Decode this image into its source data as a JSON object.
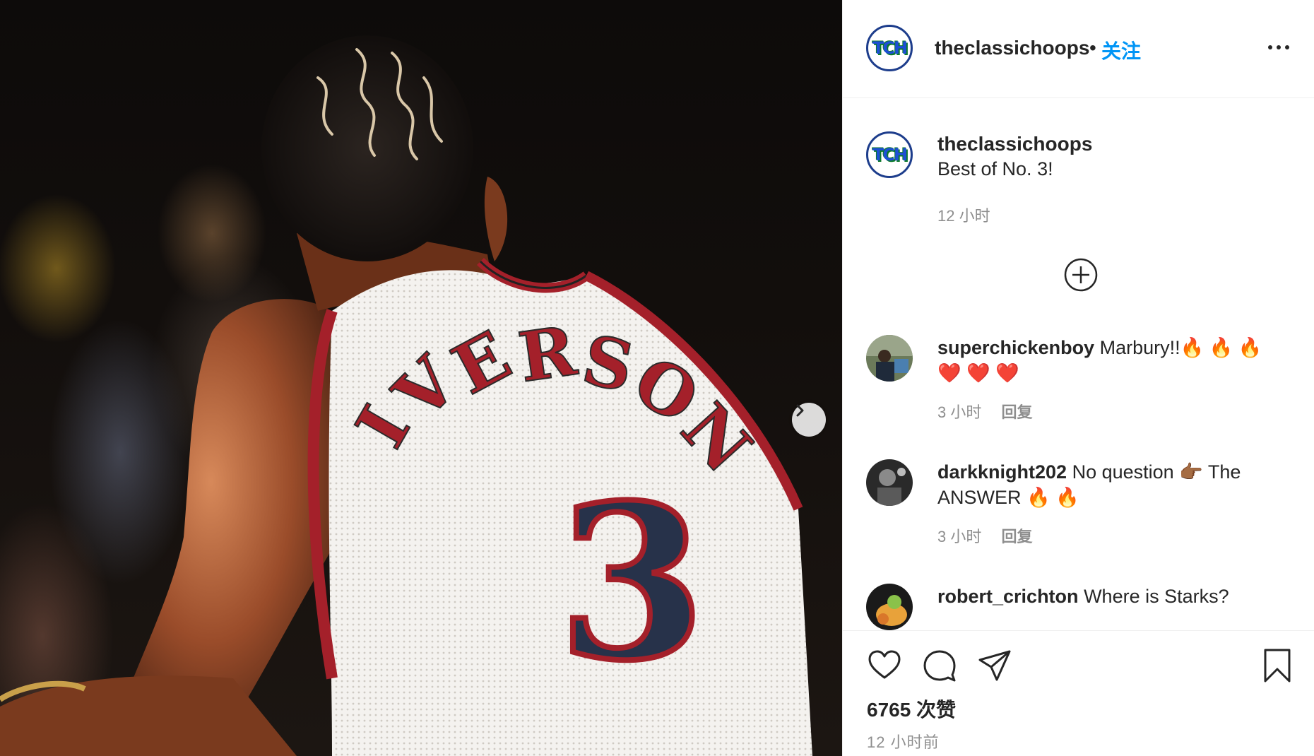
{
  "photo": {
    "alt_jersey_name": "IVERSON",
    "alt_jersey_number": "3"
  },
  "header": {
    "avatar_text": "TCH",
    "username": "theclassichoops",
    "separator": "•",
    "follow_label": "关注"
  },
  "caption": {
    "avatar_text": "TCH",
    "username": "theclassichoops",
    "text": "Best of No. 3!",
    "time": "12 小时"
  },
  "comments": [
    {
      "username": "superchickenboy",
      "text": "Marbury!!🔥 🔥 🔥 ❤️ ❤️ ❤️",
      "time": "3 小时",
      "reply": "回复"
    },
    {
      "username": "darkknight202",
      "text": "No question 👉🏾 The ANSWER 🔥 🔥",
      "time": "3 小时",
      "reply": "回复"
    },
    {
      "username": "robert_crichton",
      "text": "Where is Starks?",
      "time": "",
      "reply": ""
    }
  ],
  "footer": {
    "likes": "6765 次赞",
    "posted": "12 小时前"
  },
  "icons": {
    "next": "chevron-right-icon",
    "more": "more-horizontal-icon",
    "load_more": "plus-circle-icon",
    "like": "heart-icon",
    "comment": "comment-icon",
    "share": "paper-plane-icon",
    "save": "bookmark-icon"
  },
  "colors": {
    "link_blue": "#0095f6",
    "text": "#262626",
    "muted": "#8e8e8e",
    "jersey_red": "#a4202a",
    "jersey_navy": "#27324a"
  }
}
